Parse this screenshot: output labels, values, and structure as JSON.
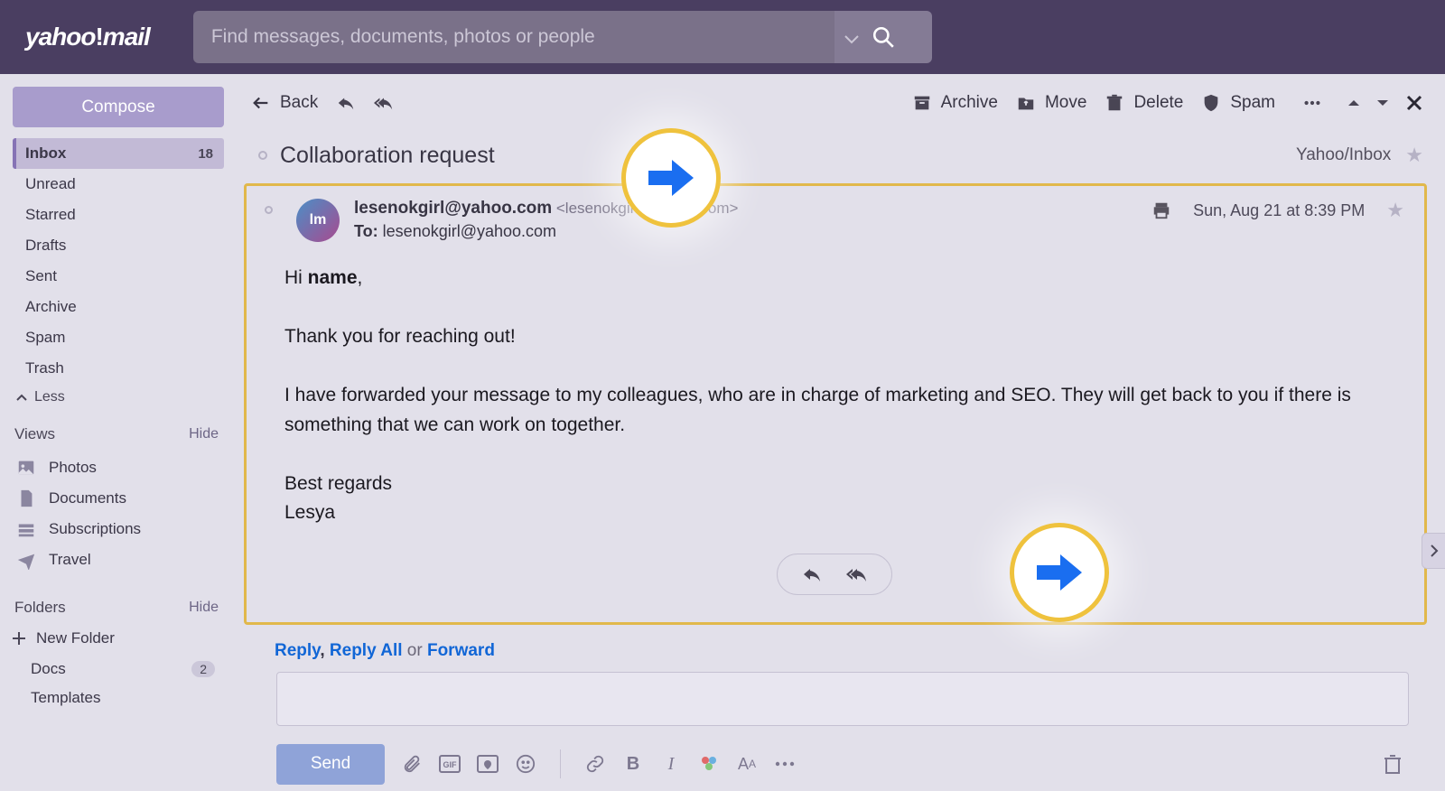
{
  "brand": {
    "name": "yahoo!mail"
  },
  "search": {
    "placeholder": "Find messages, documents, photos or people"
  },
  "sidebar": {
    "compose_label": "Compose",
    "folders": [
      {
        "label": "Inbox",
        "count": "18",
        "active": true
      },
      {
        "label": "Unread"
      },
      {
        "label": "Starred"
      },
      {
        "label": "Drafts"
      },
      {
        "label": "Sent"
      },
      {
        "label": "Archive"
      },
      {
        "label": "Spam"
      },
      {
        "label": "Trash"
      }
    ],
    "less_label": "Less",
    "views": {
      "header": "Views",
      "hide": "Hide",
      "items": [
        {
          "label": "Photos",
          "icon": "image-icon"
        },
        {
          "label": "Documents",
          "icon": "document-icon"
        },
        {
          "label": "Subscriptions",
          "icon": "subscriptions-icon"
        },
        {
          "label": "Travel",
          "icon": "plane-icon"
        }
      ]
    },
    "folders_section": {
      "header": "Folders",
      "hide": "Hide",
      "new_folder": "New Folder",
      "items": [
        {
          "label": "Docs",
          "count": "2"
        },
        {
          "label": "Templates"
        }
      ]
    }
  },
  "toolbar": {
    "back": "Back",
    "archive": "Archive",
    "move": "Move",
    "delete": "Delete",
    "spam": "Spam"
  },
  "subject": {
    "text": "Collaboration request",
    "location": "Yahoo/Inbox"
  },
  "message": {
    "from_name": "lesenokgirl@yahoo.com",
    "from_addr": "<lesenokgirl@yahoo.com>",
    "to_label": "To:",
    "to_value": "lesenokgirl@yahoo.com",
    "date": "Sun, Aug 21 at 8:39 PM",
    "avatar_initials": "lm",
    "body_greeting_prefix": "Hi ",
    "body_greeting_name": "name",
    "body_greeting_suffix": ",",
    "body_p2": "Thank you for reaching out!",
    "body_p3": "I have forwarded your message to my colleagues, who are in charge of marketing and SEO. They will get back to you if there is something that we can work on together.",
    "body_p4": "Best regards",
    "body_p5": "Lesya"
  },
  "reply_links": {
    "reply": "Reply",
    "reply_all": "Reply All",
    "or": "or",
    "forward": "Forward"
  },
  "compose_toolbar": {
    "send": "Send"
  }
}
